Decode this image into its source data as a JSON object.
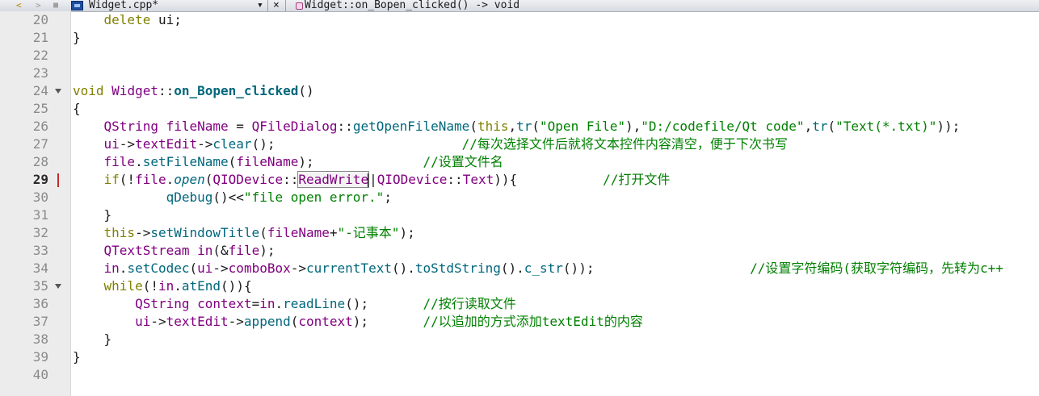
{
  "tab": {
    "filename": "Widget.cpp*",
    "function": "Widget::on_Bopen_clicked() -> void"
  },
  "icons": {
    "back": "chevron-left-icon",
    "forward": "chevron-right-icon",
    "lock": "lock-icon",
    "file": "cpp-file-icon",
    "dropdown": "dropdown-arrow-icon",
    "close": "close-icon",
    "function": "function-icon"
  },
  "toolbar_glyphs": {
    "back": "<",
    "forward": ">",
    "lock": "■",
    "dropdown": "▾",
    "close": "×"
  },
  "colors": {
    "keyword": "#808000",
    "type": "#800080",
    "function": "#00677c",
    "string": "#008000",
    "comment": "#008000",
    "gutter": "#ececec",
    "current_line_marker": "#c52b2b"
  },
  "current_line": 29,
  "code_lines": [
    {
      "number": "20",
      "tokens": [
        {
          "t": "    "
        },
        {
          "t": "delete",
          "c": "kw"
        },
        {
          "t": " ui;"
        }
      ]
    },
    {
      "number": "21",
      "tokens": [
        {
          "t": "}"
        }
      ]
    },
    {
      "number": "22",
      "tokens": []
    },
    {
      "number": "23",
      "tokens": []
    },
    {
      "number": "24",
      "fold": true,
      "tokens": [
        {
          "t": "void",
          "c": "kw"
        },
        {
          "t": " "
        },
        {
          "t": "Widget",
          "c": "ty"
        },
        {
          "t": "::"
        },
        {
          "t": "on_Bopen_clicked",
          "c": "fnd"
        },
        {
          "t": "()"
        }
      ]
    },
    {
      "number": "25",
      "tokens": [
        {
          "t": "{"
        }
      ]
    },
    {
      "number": "26",
      "tokens": [
        {
          "t": "    "
        },
        {
          "t": "QString",
          "c": "ty"
        },
        {
          "t": " "
        },
        {
          "t": "fileName",
          "c": "ty"
        },
        {
          "t": " = "
        },
        {
          "t": "QFileDialog",
          "c": "ty"
        },
        {
          "t": "::"
        },
        {
          "t": "getOpenFileName",
          "c": "fnc"
        },
        {
          "t": "("
        },
        {
          "t": "this",
          "c": "kw"
        },
        {
          "t": ","
        },
        {
          "t": "tr",
          "c": "fnc"
        },
        {
          "t": "("
        },
        {
          "t": "\"Open File\"",
          "c": "str"
        },
        {
          "t": "),"
        },
        {
          "t": "\"D:/codefile/Qt code\"",
          "c": "str"
        },
        {
          "t": ","
        },
        {
          "t": "tr",
          "c": "fnc"
        },
        {
          "t": "("
        },
        {
          "t": "\"Text(*.txt)\"",
          "c": "str"
        },
        {
          "t": "));"
        }
      ]
    },
    {
      "number": "27",
      "tokens": [
        {
          "t": "    "
        },
        {
          "t": "ui",
          "c": "ty"
        },
        {
          "t": "->"
        },
        {
          "t": "textEdit",
          "c": "ty"
        },
        {
          "t": "->"
        },
        {
          "t": "clear",
          "c": "fnc"
        },
        {
          "t": "();                        "
        },
        {
          "t": "//每次选择文件后就将文本控件内容清空，便于下次书写",
          "c": "cm"
        }
      ]
    },
    {
      "number": "28",
      "tokens": [
        {
          "t": "    "
        },
        {
          "t": "file",
          "c": "ty"
        },
        {
          "t": "."
        },
        {
          "t": "setFileName",
          "c": "fnc"
        },
        {
          "t": "("
        },
        {
          "t": "fileName",
          "c": "ty"
        },
        {
          "t": ");              "
        },
        {
          "t": "//设置文件名",
          "c": "cm"
        }
      ]
    },
    {
      "number": "29",
      "current": true,
      "tokens": [
        {
          "t": "    "
        },
        {
          "t": "if",
          "c": "kw"
        },
        {
          "t": "(!"
        },
        {
          "t": "file",
          "c": "ty"
        },
        {
          "t": "."
        },
        {
          "t": "open",
          "c": "it"
        },
        {
          "t": "("
        },
        {
          "t": "QIODevice",
          "c": "ty"
        },
        {
          "t": "::"
        },
        {
          "t": "ReadWrite",
          "c": "en"
        },
        {
          "t": "",
          "cursor": true
        },
        {
          "t": "|"
        },
        {
          "t": "QIODevice",
          "c": "ty"
        },
        {
          "t": "::"
        },
        {
          "t": "Text",
          "c": "ty"
        },
        {
          "t": ")){           "
        },
        {
          "t": "//打开文件",
          "c": "cm"
        }
      ]
    },
    {
      "number": "30",
      "tokens": [
        {
          "t": "            "
        },
        {
          "t": "qDebug",
          "c": "fnc"
        },
        {
          "t": "()<<"
        },
        {
          "t": "\"file open error.\"",
          "c": "str"
        },
        {
          "t": ";"
        }
      ]
    },
    {
      "number": "31",
      "tokens": [
        {
          "t": "    }"
        }
      ]
    },
    {
      "number": "32",
      "tokens": [
        {
          "t": "    "
        },
        {
          "t": "this",
          "c": "kw"
        },
        {
          "t": "->"
        },
        {
          "t": "setWindowTitle",
          "c": "fnc"
        },
        {
          "t": "("
        },
        {
          "t": "fileName",
          "c": "ty"
        },
        {
          "t": "+"
        },
        {
          "t": "\"-记事本\"",
          "c": "str"
        },
        {
          "t": ");"
        }
      ]
    },
    {
      "number": "33",
      "tokens": [
        {
          "t": "    "
        },
        {
          "t": "QTextStream",
          "c": "ty"
        },
        {
          "t": " "
        },
        {
          "t": "in",
          "c": "ty"
        },
        {
          "t": "(&"
        },
        {
          "t": "file",
          "c": "ty"
        },
        {
          "t": ");"
        }
      ]
    },
    {
      "number": "34",
      "tokens": [
        {
          "t": "    "
        },
        {
          "t": "in",
          "c": "ty"
        },
        {
          "t": "."
        },
        {
          "t": "setCodec",
          "c": "fnc"
        },
        {
          "t": "("
        },
        {
          "t": "ui",
          "c": "ty"
        },
        {
          "t": "->"
        },
        {
          "t": "comboBox",
          "c": "ty"
        },
        {
          "t": "->"
        },
        {
          "t": "currentText",
          "c": "fnc"
        },
        {
          "t": "()."
        },
        {
          "t": "toStdString",
          "c": "fnc"
        },
        {
          "t": "()."
        },
        {
          "t": "c_str",
          "c": "fnc"
        },
        {
          "t": "());                    "
        },
        {
          "t": "//设置字符编码(获取字符编码，先转为c++",
          "c": "cm"
        }
      ]
    },
    {
      "number": "35",
      "fold": true,
      "tokens": [
        {
          "t": "    "
        },
        {
          "t": "while",
          "c": "kw"
        },
        {
          "t": "(!"
        },
        {
          "t": "in",
          "c": "ty"
        },
        {
          "t": "."
        },
        {
          "t": "atEnd",
          "c": "fnc"
        },
        {
          "t": "()){"
        }
      ]
    },
    {
      "number": "36",
      "tokens": [
        {
          "t": "        "
        },
        {
          "t": "QString",
          "c": "ty"
        },
        {
          "t": " "
        },
        {
          "t": "context",
          "c": "ty"
        },
        {
          "t": "="
        },
        {
          "t": "in",
          "c": "ty"
        },
        {
          "t": "."
        },
        {
          "t": "readLine",
          "c": "fnc"
        },
        {
          "t": "();       "
        },
        {
          "t": "//按行读取文件",
          "c": "cm"
        }
      ]
    },
    {
      "number": "37",
      "tokens": [
        {
          "t": "        "
        },
        {
          "t": "ui",
          "c": "ty"
        },
        {
          "t": "->"
        },
        {
          "t": "textEdit",
          "c": "ty"
        },
        {
          "t": "->"
        },
        {
          "t": "append",
          "c": "fnc"
        },
        {
          "t": "("
        },
        {
          "t": "context",
          "c": "ty"
        },
        {
          "t": ");       "
        },
        {
          "t": "//以追加的方式添加textEdit的内容",
          "c": "cm"
        }
      ]
    },
    {
      "number": "38",
      "tokens": [
        {
          "t": "    }"
        }
      ]
    },
    {
      "number": "39",
      "tokens": [
        {
          "t": "}"
        }
      ]
    },
    {
      "number": "40",
      "tokens": []
    }
  ]
}
